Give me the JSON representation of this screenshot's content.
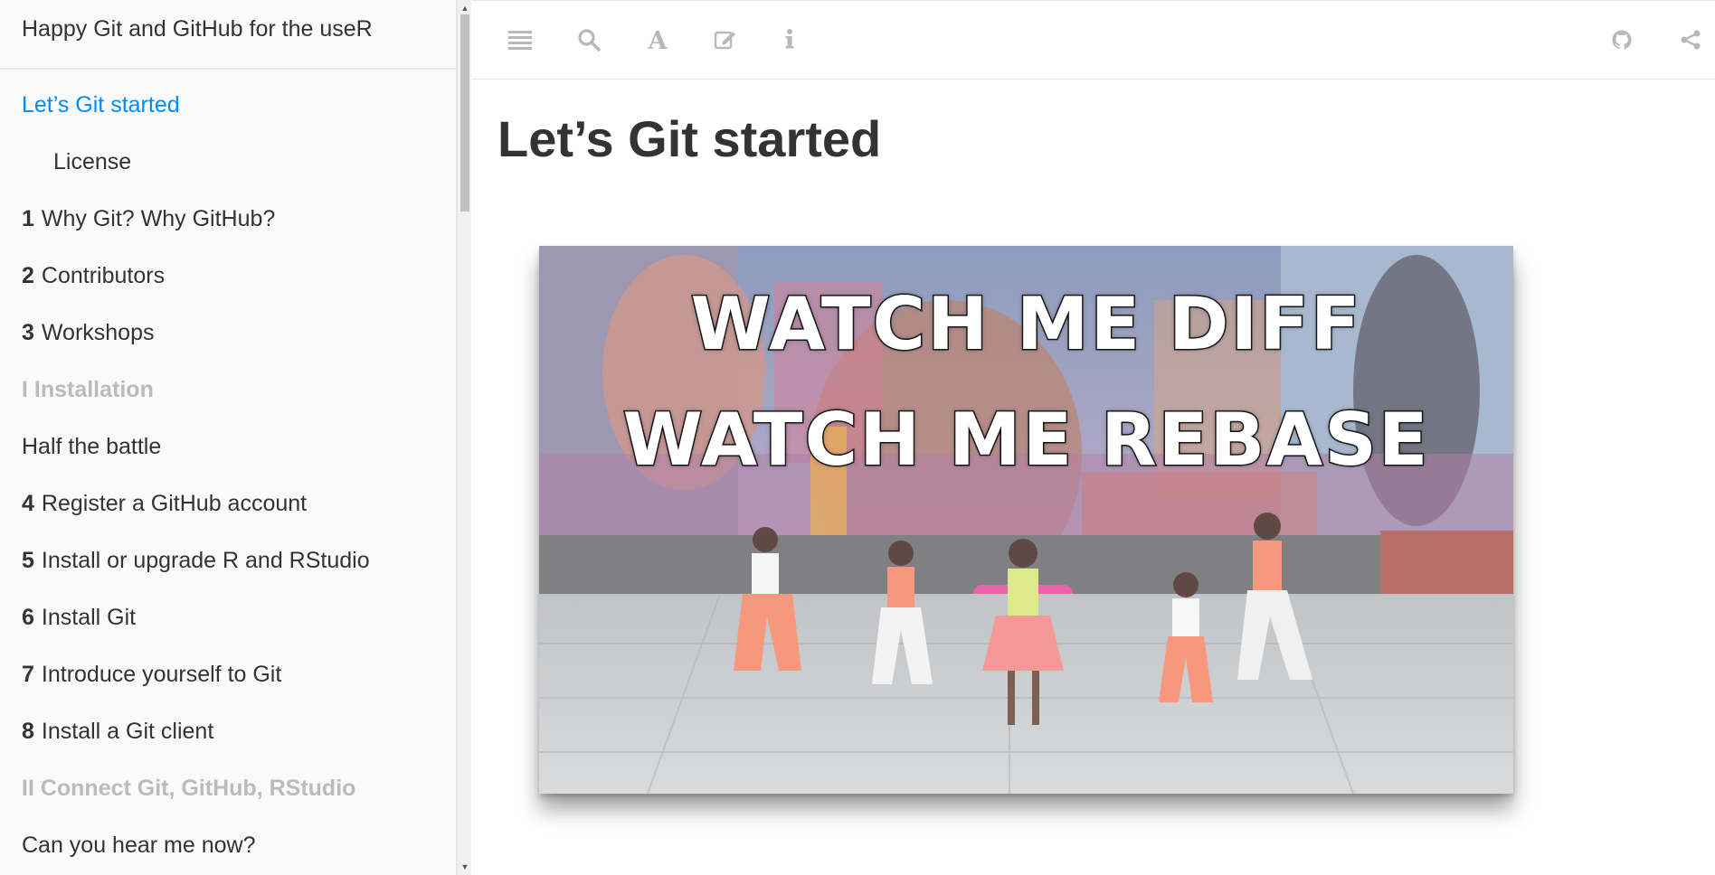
{
  "sidebar": {
    "book_title": "Happy Git and GitHub for the useR",
    "items": [
      {
        "num": "",
        "label": "Let’s Git started",
        "kind": "active"
      },
      {
        "num": "",
        "label": "License",
        "kind": "indent"
      },
      {
        "num": "1",
        "label": "Why Git? Why GitHub?",
        "kind": "chapter"
      },
      {
        "num": "2",
        "label": "Contributors",
        "kind": "chapter"
      },
      {
        "num": "3",
        "label": "Workshops",
        "kind": "chapter"
      },
      {
        "num": "",
        "label": "I Installation",
        "kind": "part"
      },
      {
        "num": "",
        "label": "Half the battle",
        "kind": "chapter"
      },
      {
        "num": "4",
        "label": "Register a GitHub account",
        "kind": "chapter"
      },
      {
        "num": "5",
        "label": "Install or upgrade R and RStudio",
        "kind": "chapter"
      },
      {
        "num": "6",
        "label": "Install Git",
        "kind": "chapter"
      },
      {
        "num": "7",
        "label": "Introduce yourself to Git",
        "kind": "chapter"
      },
      {
        "num": "8",
        "label": "Install a Git client",
        "kind": "chapter"
      },
      {
        "num": "",
        "label": "II Connect Git, GitHub, RStudio",
        "kind": "part"
      },
      {
        "num": "",
        "label": "Can you hear me now?",
        "kind": "chapter"
      }
    ]
  },
  "toolbar": {
    "icons": [
      "toc-toggle-icon",
      "search-icon",
      "font-settings-icon",
      "edit-icon",
      "info-icon",
      "github-icon",
      "share-icon"
    ]
  },
  "main": {
    "page_title": "Let’s Git started",
    "video": {
      "line1": "WATCH ME DIFF",
      "line2": "WATCH ME REBASE"
    }
  },
  "colors": {
    "active_link": "#008cff",
    "part_heading": "#bbbbbb",
    "toolbar_icon": "#b8b8b8"
  }
}
